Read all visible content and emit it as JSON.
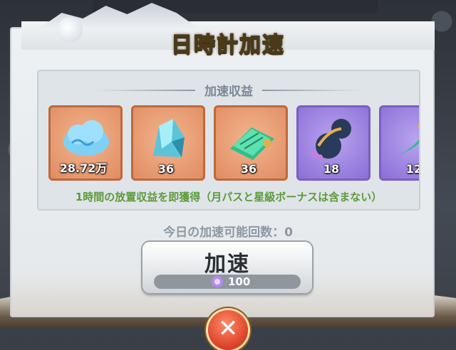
{
  "title": "日時計加速",
  "rewards": {
    "heading": "加速収益",
    "items": [
      {
        "name": "cloud",
        "qty": "28.72万"
      },
      {
        "name": "crystal",
        "qty": "36"
      },
      {
        "name": "jade-scroll",
        "qty": "36"
      },
      {
        "name": "gourd",
        "qty": "18"
      },
      {
        "name": "leaf-blade",
        "qty": "12"
      }
    ],
    "note": "1時間の放置収益を即獲得（月パスと星級ボーナスは含まない）"
  },
  "accelerate": {
    "count_text": "今日の加速可能回数：0",
    "button_label": "加速",
    "cost": "100",
    "cost_icon": "purple-gem-icon"
  },
  "close": {
    "label": "✕"
  },
  "colors": {
    "title": "#fff3b0",
    "note": "#5c9a3a",
    "close": "#e04a2f",
    "purple_frame": "#7a5fc4",
    "orange_frame": "#c0683a"
  }
}
